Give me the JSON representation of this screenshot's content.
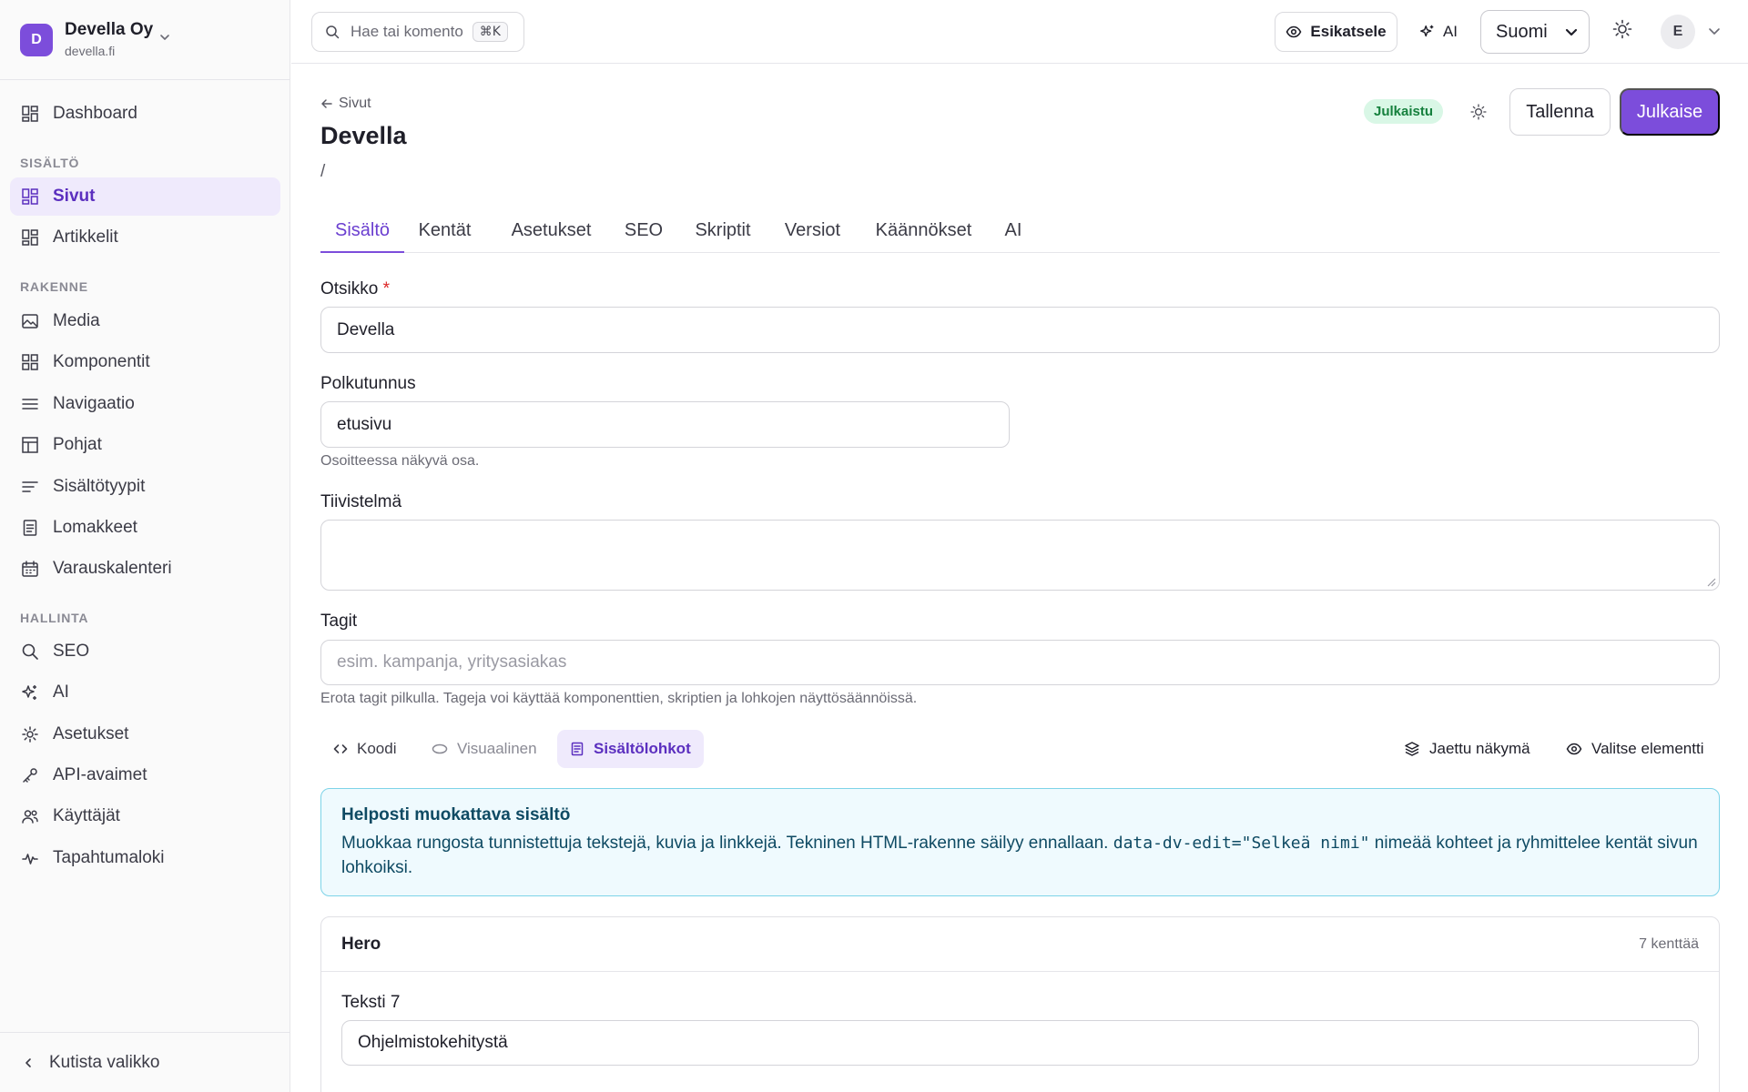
{
  "workspace": {
    "initial": "D",
    "name": "Devella Oy",
    "domain": "devella.fi"
  },
  "sidebar": {
    "dashboard": "Dashboard",
    "sections": {
      "content": "SISÄLTÖ",
      "structure": "RAKENNE",
      "admin": "HALLINTA"
    },
    "content_items": [
      {
        "label": "Sivut",
        "icon": "grid-icon",
        "active": true
      },
      {
        "label": "Artikkelit",
        "icon": "grid-icon"
      }
    ],
    "structure_items": [
      {
        "label": "Media",
        "icon": "image-icon"
      },
      {
        "label": "Komponentit",
        "icon": "grid-icon"
      },
      {
        "label": "Navigaatio",
        "icon": "menu-icon"
      },
      {
        "label": "Pohjat",
        "icon": "layout-icon"
      },
      {
        "label": "Sisältötyypit",
        "icon": "text-align-icon"
      },
      {
        "label": "Lomakkeet",
        "icon": "form-icon"
      },
      {
        "label": "Varauskalenteri",
        "icon": "calendar-icon"
      }
    ],
    "admin_items": [
      {
        "label": "SEO",
        "icon": "search-icon"
      },
      {
        "label": "AI",
        "icon": "sparkles-icon"
      },
      {
        "label": "Asetukset",
        "icon": "gear-icon"
      },
      {
        "label": "API-avaimet",
        "icon": "key-icon"
      },
      {
        "label": "Käyttäjät",
        "icon": "users-icon"
      },
      {
        "label": "Tapahtumaloki",
        "icon": "activity-icon"
      }
    ],
    "collapse_label": "Kutista valikko"
  },
  "topbar": {
    "search_placeholder": "Hae tai komento",
    "search_shortcut": "⌘K",
    "preview_label": "Esikatsele",
    "ai_label": "AI",
    "language": "Suomi",
    "user_initial": "E"
  },
  "page": {
    "back_label": "Sivut",
    "title": "Devella",
    "path": "/",
    "status": "Julkaistu",
    "save_label": "Tallenna",
    "publish_label": "Julkaise"
  },
  "tabs": [
    "Sisältö",
    "Kentät",
    "Asetukset",
    "SEO",
    "Skriptit",
    "Versiot",
    "Käännökset",
    "AI"
  ],
  "form": {
    "title_label": "Otsikko",
    "title_required": "*",
    "title_value": "Devella",
    "slug_label": "Polkutunnus",
    "slug_value": "etusivu",
    "slug_hint": "Osoitteessa näkyvä osa.",
    "summary_label": "Tiivistelmä",
    "summary_value": "",
    "tags_label": "Tagit",
    "tags_placeholder": "esim. kampanja, yritysasiakas",
    "tags_hint": "Erota tagit pilkulla. Tageja voi käyttää komponenttien, skriptien ja lohkojen näyttösäännöissä."
  },
  "editor_modes": {
    "code": "Koodi",
    "visual": "Visuaalinen",
    "blocks": "Sisältölohkot",
    "active": "blocks",
    "shared_view": "Jaettu näkymä",
    "select_element": "Valitse elementti"
  },
  "callout": {
    "title": "Helposti muokattava sisältö",
    "text_before": "Muokkaa rungosta tunnistettuja tekstejä, kuvia ja linkkejä. Tekninen HTML-rakenne säilyy ennallaan. ",
    "code": "data-dv-edit=\"Selkeä nimi\"",
    "text_after": " nimeää kohteet ja ryhmittelee kentät sivun lohkoiksi."
  },
  "block": {
    "title": "Hero",
    "field_count": "7 kenttää",
    "field_label": "Teksti 7",
    "field_value": "Ohjelmistokehitystä"
  },
  "colors": {
    "accent": "#7c4ddb",
    "active_bg": "#efeafc",
    "success_bg": "#d9f7e6",
    "success_text": "#15803d",
    "info_bg": "#effafe",
    "info_border": "#7dd3e8"
  }
}
